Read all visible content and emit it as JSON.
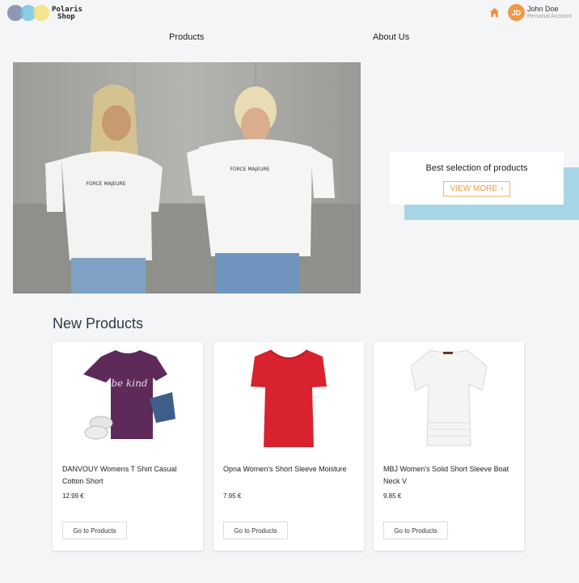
{
  "header": {
    "logo_line1": "Polaris",
    "logo_line2": "Shop",
    "user_initials": "JD",
    "user_name": "John Doe",
    "user_subtitle": "Personal Account"
  },
  "nav": {
    "products": "Products",
    "about": "About Us"
  },
  "hero": {
    "promo_text": "Best selection of products",
    "promo_button": "VIEW MORE",
    "accent_color": "#a6d6e6",
    "button_color": "#ef9a3f"
  },
  "section": {
    "title": "New Products"
  },
  "products": [
    {
      "name": "DANVOUY Womens T Shirt Casual Cotton Short",
      "price": "12.99 €",
      "button": "Go to Products",
      "image": "purple-tshirt",
      "image_text": "be kind"
    },
    {
      "name": "Opna Women's Short Sleeve Moisture",
      "price": "7.95 €",
      "button": "Go to Products",
      "image": "red-tshirt"
    },
    {
      "name": "MBJ Women's Solid Short Sleeve Boat Neck V",
      "price": "9.85 €",
      "button": "Go to Products",
      "image": "white-top"
    }
  ]
}
